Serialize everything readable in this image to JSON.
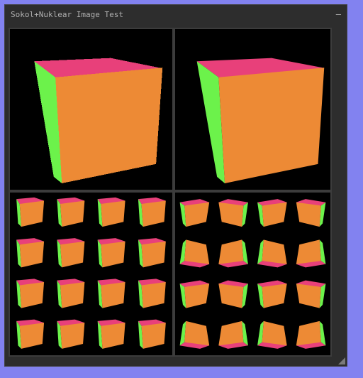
{
  "window": {
    "title": "Sokol+Nuklear Image Test",
    "minimize_symbol": "–"
  },
  "colors": {
    "background": "#8282f0",
    "window_bg": "#2d2d2d",
    "cube_top": "#e8407a",
    "cube_front": "#ed8a35",
    "cube_side": "#6cf24b"
  },
  "icons": {
    "minimize": "minimize-icon",
    "resize": "resize-grip-icon"
  }
}
